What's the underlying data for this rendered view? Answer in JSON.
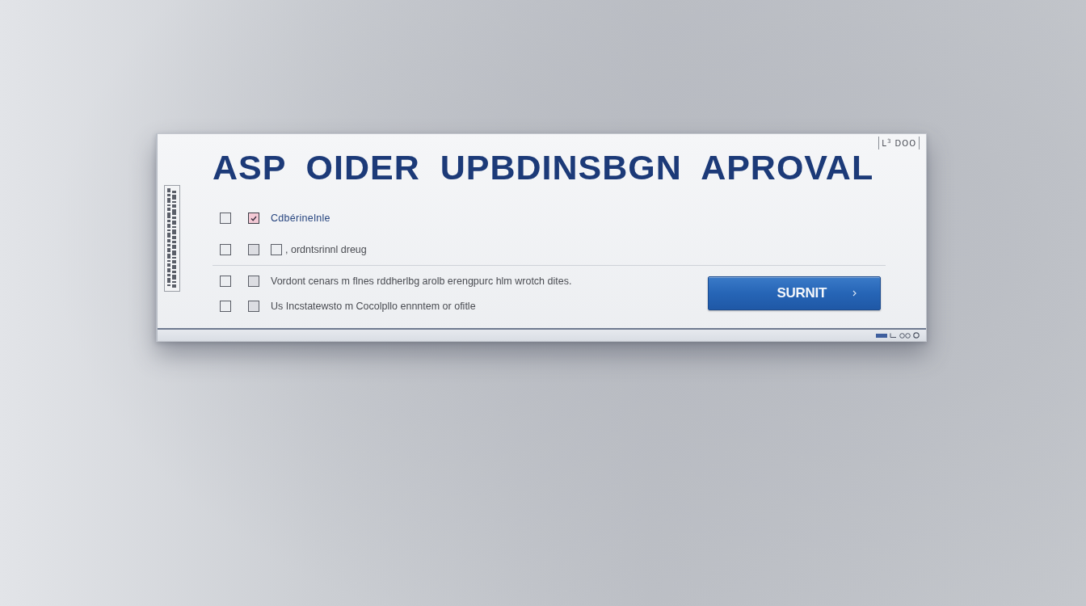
{
  "dialog": {
    "corner_label": "L$^{3}$ DOO",
    "title": "ASP OIDER UPBDINSBGN APROVAL",
    "option_groups": [
      {
        "options": [
          {
            "selected": true,
            "checkboxes": [
              {
                "checked": false
              },
              {
                "checked": true
              }
            ],
            "text": "Cdbérinelnle"
          },
          {
            "selected": false,
            "checkboxes": [
              {
                "checked": false
              },
              {
                "checked": false
              },
              {
                "checked": false
              }
            ],
            "text": ", ordntsrinnl dreug"
          }
        ]
      },
      {
        "options": [
          {
            "selected": false,
            "checkboxes": [
              {
                "checked": false
              },
              {
                "checked": false
              }
            ],
            "text": "Vordont cenars m flnes rddherlbg arolb erengpurc hlm wrotch dites."
          },
          {
            "selected": false,
            "checkboxes": [
              {
                "checked": false
              },
              {
                "checked": false
              }
            ],
            "text": "Us Incstatewsto m Cocolpllo ennntem or ofitle"
          }
        ]
      }
    ],
    "submit_button": {
      "label": "SURNIT"
    }
  }
}
